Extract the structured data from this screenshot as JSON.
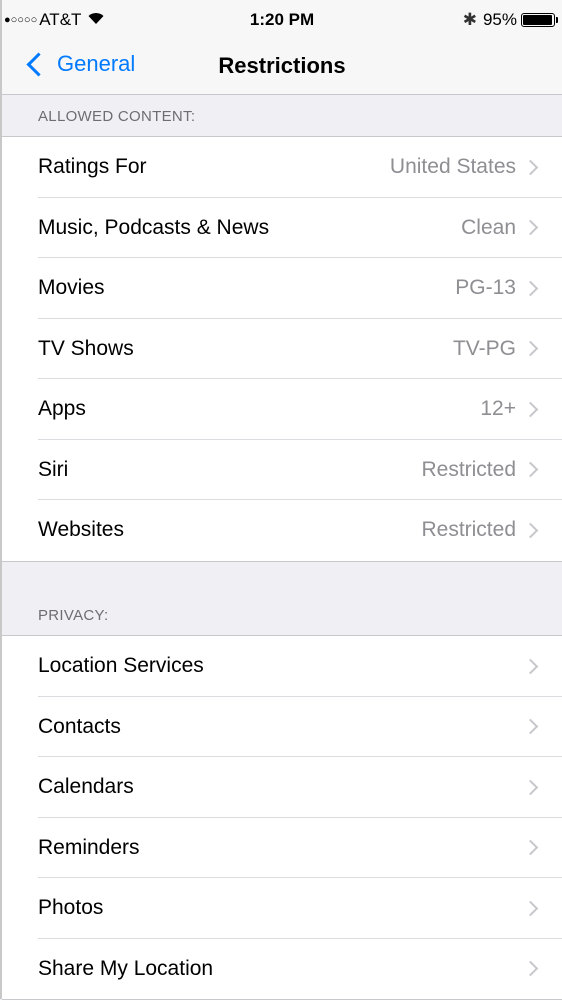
{
  "status_bar": {
    "signal_dots": "●○○○○",
    "carrier": "AT&T",
    "time": "1:20 PM",
    "bluetooth": "✱",
    "battery_percent": "95%",
    "battery_level": 0.95
  },
  "nav": {
    "back_label": "General",
    "title": "Restrictions"
  },
  "sections": {
    "allowed_content": {
      "header": "ALLOWED CONTENT:",
      "rows": [
        {
          "label": "Ratings For",
          "value": "United States"
        },
        {
          "label": "Music, Podcasts & News",
          "value": "Clean"
        },
        {
          "label": "Movies",
          "value": "PG-13"
        },
        {
          "label": "TV Shows",
          "value": "TV-PG"
        },
        {
          "label": "Apps",
          "value": "12+"
        },
        {
          "label": "Siri",
          "value": "Restricted"
        },
        {
          "label": "Websites",
          "value": "Restricted"
        }
      ]
    },
    "privacy": {
      "header": "PRIVACY:",
      "rows": [
        {
          "label": "Location Services"
        },
        {
          "label": "Contacts"
        },
        {
          "label": "Calendars"
        },
        {
          "label": "Reminders"
        },
        {
          "label": "Photos"
        },
        {
          "label": "Share My Location"
        }
      ]
    }
  }
}
